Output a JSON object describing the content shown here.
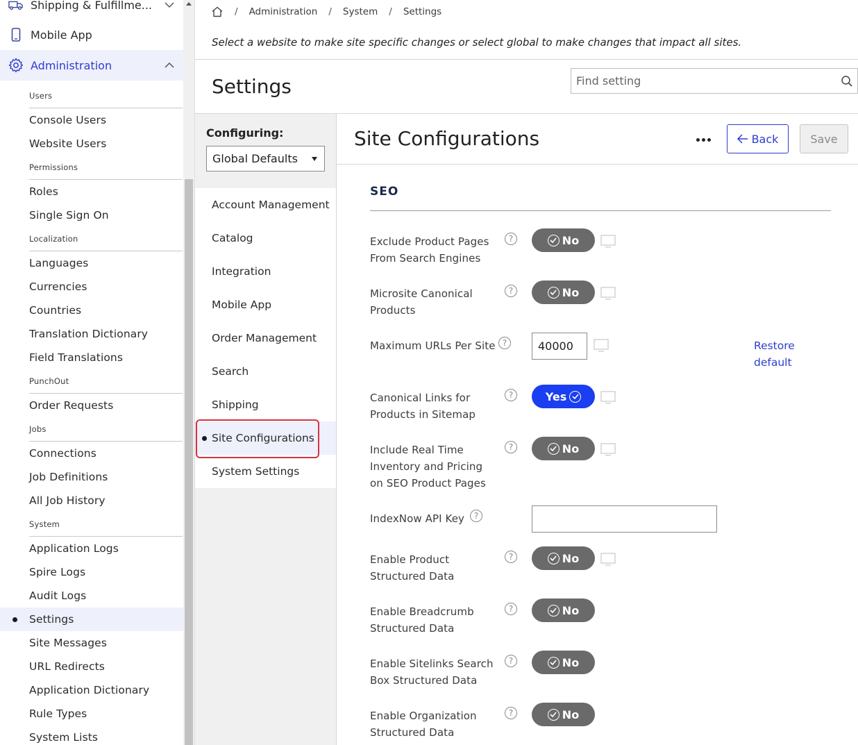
{
  "nav": {
    "top_items": [
      {
        "label": "Shipping & Fulfillme...",
        "icon": "truck-icon"
      },
      {
        "label": "Mobile App",
        "icon": "mobile-icon"
      },
      {
        "label": "Administration",
        "icon": "gear-icon"
      }
    ],
    "groups": [
      {
        "heading": "Users",
        "items": [
          "Console Users",
          "Website Users"
        ]
      },
      {
        "heading": "Permissions",
        "items": [
          "Roles",
          "Single Sign On"
        ]
      },
      {
        "heading": "Localization",
        "items": [
          "Languages",
          "Currencies",
          "Countries",
          "Translation Dictionary",
          "Field Translations"
        ]
      },
      {
        "heading": "PunchOut",
        "items": [
          "Order Requests"
        ]
      },
      {
        "heading": "Jobs",
        "items": [
          "Connections",
          "Job Definitions",
          "All Job History"
        ]
      },
      {
        "heading": "System",
        "items": [
          "Application Logs",
          "Spire Logs",
          "Audit Logs",
          "Settings",
          "Site Messages",
          "URL Redirects",
          "Application Dictionary",
          "Rule Types",
          "System Lists"
        ]
      }
    ]
  },
  "breadcrumb": [
    "Administration",
    "System",
    "Settings"
  ],
  "notice": "Select a website to make site specific changes or select global to make changes that impact all sites.",
  "page_title": "Settings",
  "search": {
    "placeholder": "Find setting",
    "value": ""
  },
  "configuring": {
    "label": "Configuring:",
    "selected": "Global Defaults",
    "categories": [
      "Account Management",
      "Catalog",
      "Integration",
      "Mobile App",
      "Order Management",
      "Search",
      "Shipping",
      "Site Configurations",
      "System Settings"
    ],
    "active_category": "Site Configurations"
  },
  "panel": {
    "title": "Site Configurations",
    "back_label": "Back",
    "save_label": "Save",
    "section": "SEO",
    "restore_label": "Restore default",
    "settings": [
      {
        "label": "Exclude Product Pages From Search Engines",
        "type": "toggle",
        "value": "No"
      },
      {
        "label": "Microsite Canonical Products",
        "type": "toggle",
        "value": "No"
      },
      {
        "label": "Maximum URLs Per Site",
        "type": "number",
        "value": "40000"
      },
      {
        "label": "Canonical Links for Products in Sitemap",
        "type": "toggle",
        "value": "Yes"
      },
      {
        "label": "Include Real Time Inventory and Pricing on SEO Product Pages",
        "type": "toggle",
        "value": "No"
      },
      {
        "label": "IndexNow API Key",
        "type": "text",
        "value": ""
      },
      {
        "label": "Enable Product Structured Data",
        "type": "toggle",
        "value": "No"
      },
      {
        "label": "Enable Breadcrumb Structured Data",
        "type": "toggle",
        "value": "No"
      },
      {
        "label": "Enable Sitelinks Search Box Structured Data",
        "type": "toggle",
        "value": "No"
      },
      {
        "label": "Enable Organization Structured Data",
        "type": "toggle",
        "value": "No"
      }
    ]
  },
  "colors": {
    "accent": "#2d3cd0",
    "toggle_yes": "#1a3ef0",
    "toggle_no": "#6a6a6a",
    "highlight": "#d5343f"
  }
}
